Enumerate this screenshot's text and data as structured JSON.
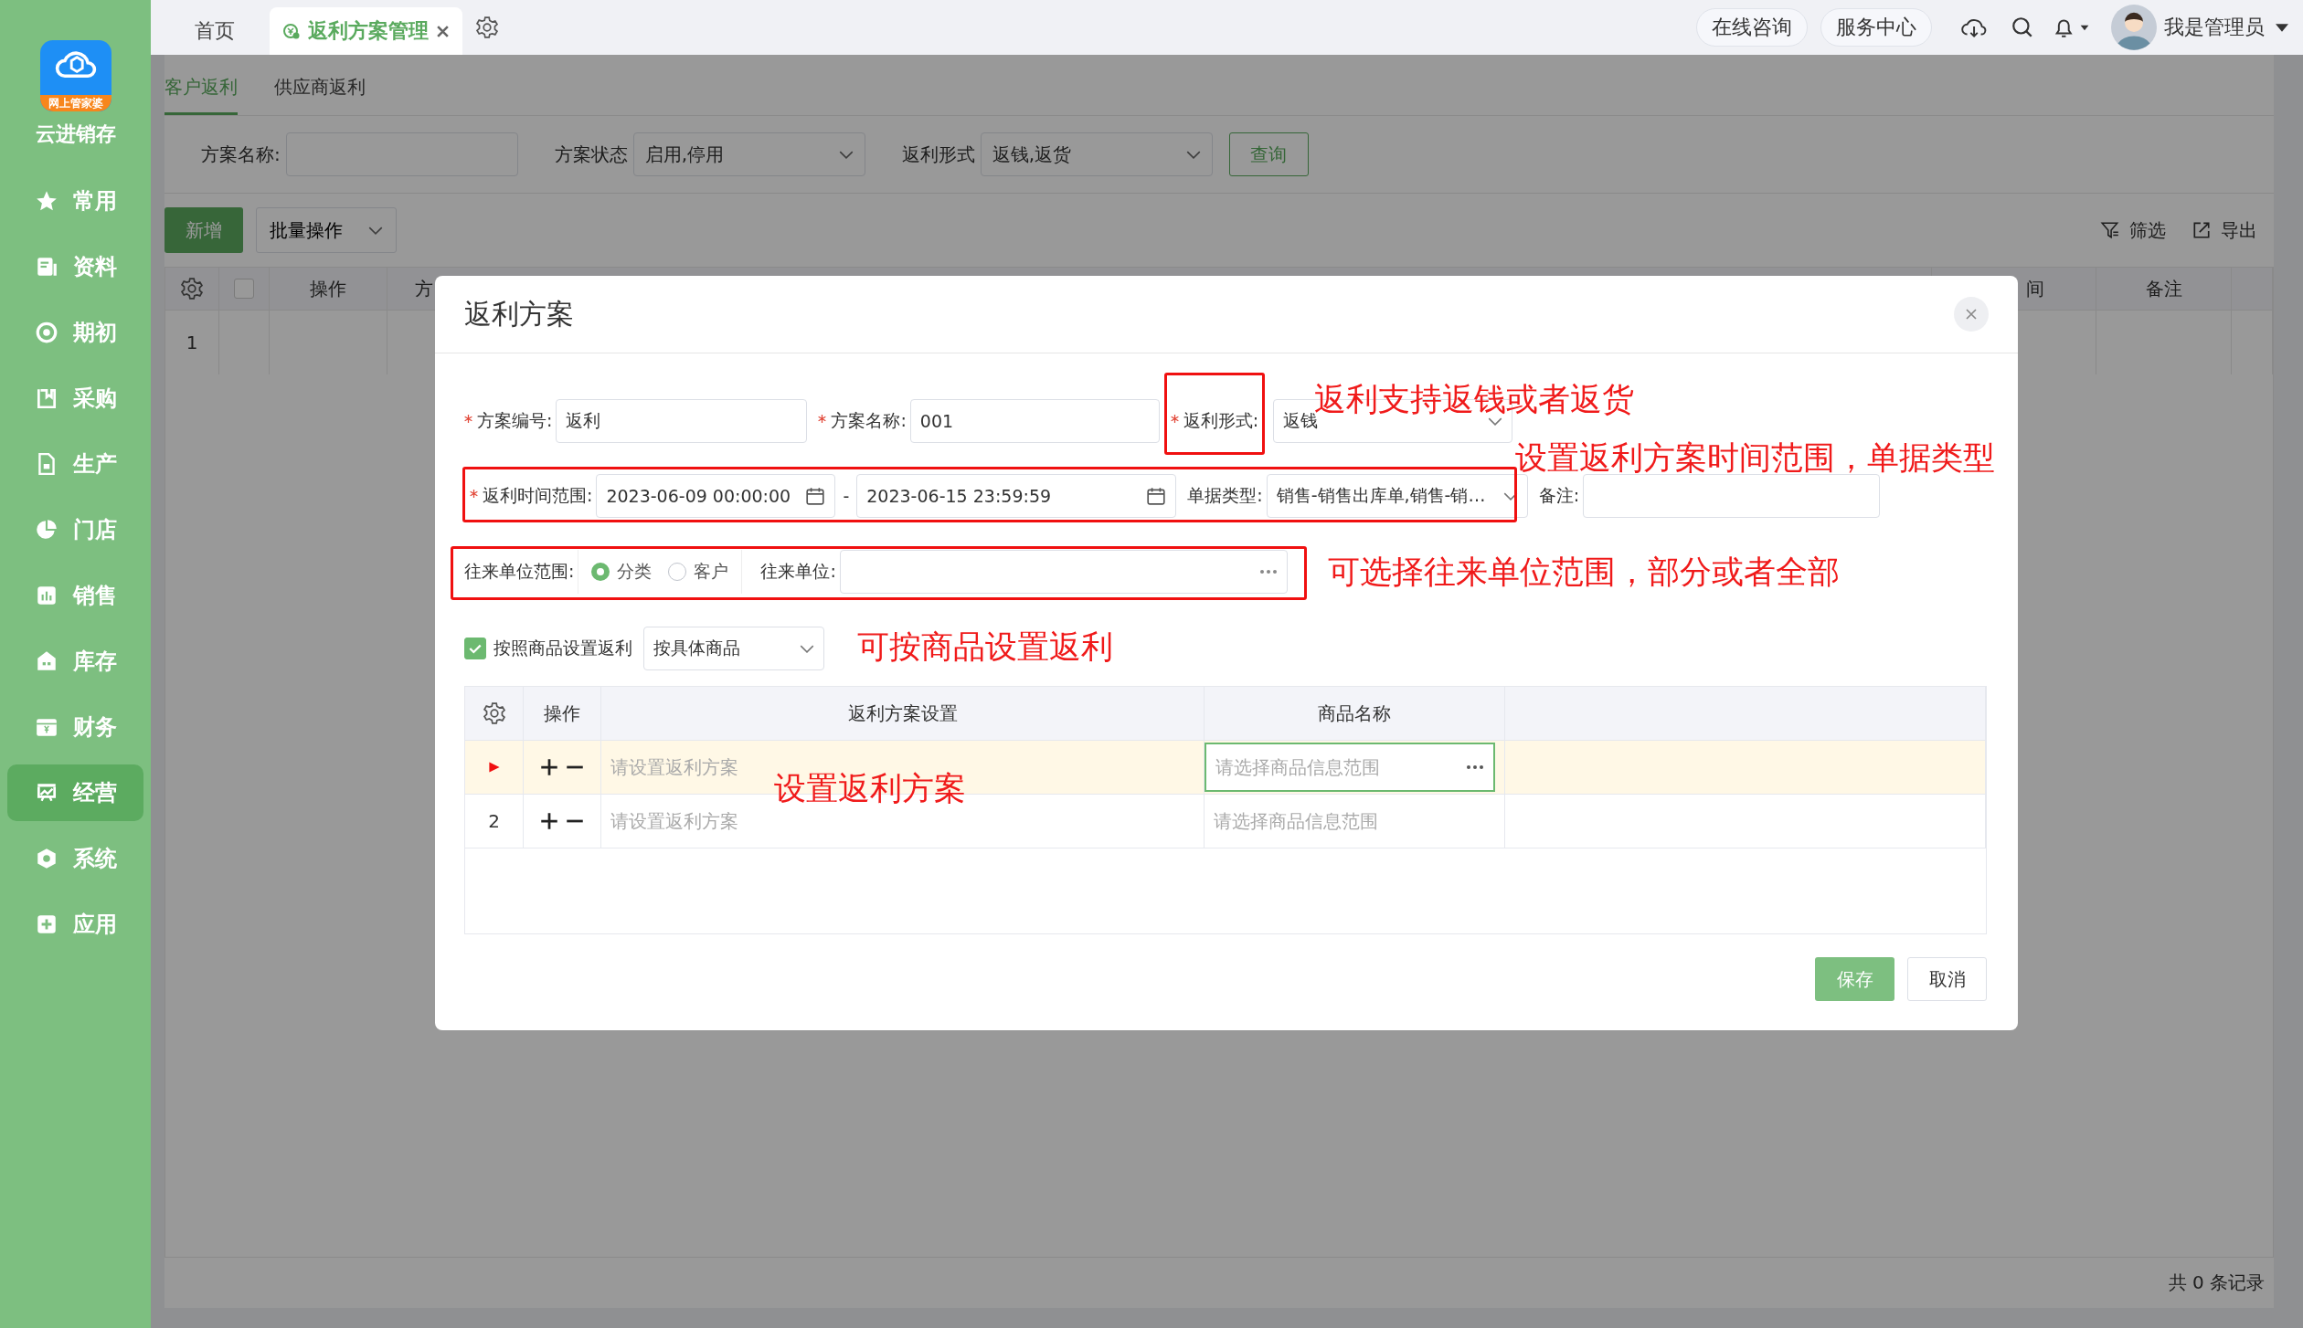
{
  "sidebar": {
    "logo_badge": "网上管家婆",
    "app_name": "云进销存",
    "items": [
      {
        "label": "常用",
        "selected": false
      },
      {
        "label": "资料",
        "selected": false
      },
      {
        "label": "期初",
        "selected": false
      },
      {
        "label": "采购",
        "selected": false
      },
      {
        "label": "生产",
        "selected": false
      },
      {
        "label": "门店",
        "selected": false
      },
      {
        "label": "销售",
        "selected": false
      },
      {
        "label": "库存",
        "selected": false
      },
      {
        "label": "财务",
        "selected": false
      },
      {
        "label": "经营",
        "selected": true
      },
      {
        "label": "系统",
        "selected": false
      },
      {
        "label": "应用",
        "selected": false
      }
    ]
  },
  "top_bar": {
    "tabs": [
      {
        "label": "首页",
        "selected": false,
        "closable": false
      },
      {
        "label": "返利方案管理",
        "selected": true,
        "closable": true
      }
    ],
    "links": [
      "在线咨询",
      "服务中心"
    ],
    "user": "我是管理员"
  },
  "page": {
    "subtabs": [
      {
        "label": "客户返利",
        "selected": true
      },
      {
        "label": "供应商返利",
        "selected": false
      }
    ],
    "filters": [
      {
        "label": "方案名称:",
        "kind": "input"
      },
      {
        "label": "方案状态",
        "kind": "select",
        "value": "启用,停用"
      },
      {
        "label": "返利形式",
        "kind": "select",
        "value": "返钱,返货"
      }
    ],
    "query_button": "查询",
    "add_button": "新增",
    "batch_button": "批量操作",
    "filter_link": "筛选",
    "export_link": "导出",
    "table": {
      "select_all_checked": false,
      "columns": [
        "操作",
        "方",
        "间",
        "备注"
      ],
      "rows": [
        "1"
      ]
    },
    "footer": "共 0 条记录"
  },
  "dialog": {
    "title": "返利方案",
    "form": {
      "basic": [
        {
          "kind": "input",
          "label": "方案编号:",
          "required": true,
          "value": "返利"
        },
        {
          "kind": "input",
          "label": "方案名称:",
          "required": true,
          "value": "001"
        },
        {
          "kind": "select",
          "label": "返利形式:",
          "required": true,
          "value": "返钱"
        }
      ],
      "period": [
        {
          "kind": "date",
          "label": "返利时间范围:",
          "required": true,
          "value": "2023-06-09 00:00:00"
        },
        {
          "kind": "separator",
          "text": "-"
        },
        {
          "kind": "date",
          "value": "2023-06-15 23:59:59"
        },
        {
          "kind": "select",
          "label": "单据类型:",
          "required": false,
          "value": "销售-销售出库单,销售-销…"
        },
        {
          "kind": "input",
          "label": "备注:",
          "required": false
        }
      ],
      "partner": [
        {
          "kind": "radio",
          "label": "往来单位范围:",
          "required": false,
          "options": [
            {
              "label": "分类",
              "selected": true
            },
            {
              "label": "客户",
              "selected": false
            }
          ]
        },
        {
          "kind": "picker",
          "label": "往来单位:",
          "required": false
        }
      ],
      "product": [
        {
          "kind": "checkbox",
          "label": "按照商品设置返利",
          "checked": true
        },
        {
          "kind": "select",
          "value": "按具体商品"
        }
      ]
    },
    "table": {
      "columns": [
        "操作",
        "返利方案设置",
        "商品名称"
      ],
      "rows": [
        {
          "current": true,
          "plan_placeholder": "请设置返利方案",
          "product_placeholder": "请选择商品信息范围"
        },
        {
          "current": false,
          "index": "2",
          "plan_placeholder": "请设置返利方案",
          "product_placeholder": "请选择商品信息范围"
        }
      ]
    },
    "buttons": [
      {
        "label": "保存",
        "kind": "primary"
      },
      {
        "label": "取消",
        "kind": "default"
      }
    ]
  },
  "annotations": [
    "返利支持返钱或者返货",
    "设置返利方案时间范围，单据类型",
    "可选择往来单位范围，部分或者全部",
    "可按商品设置返利",
    "设置返利方案"
  ]
}
